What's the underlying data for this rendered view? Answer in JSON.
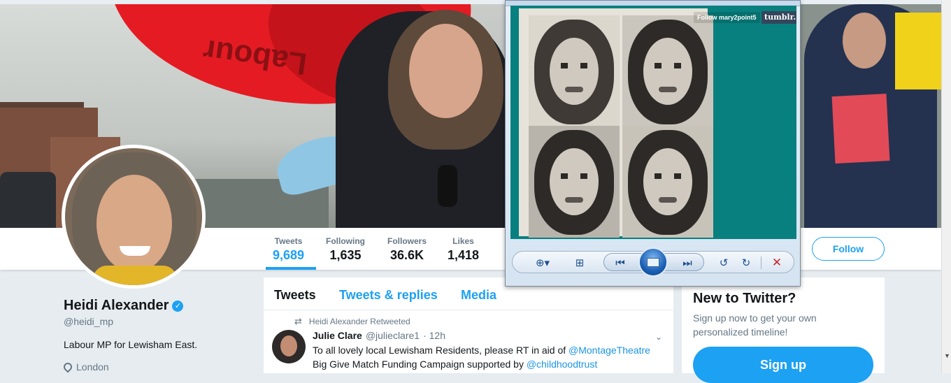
{
  "profile": {
    "name": "Heidi Alexander",
    "handle": "@heidi_mp",
    "bio": "Labour MP for Lewisham East.",
    "location": "London",
    "verified_glyph": "✓"
  },
  "banner": {
    "umbrella_text": "Labour"
  },
  "stats": [
    {
      "label": "Tweets",
      "value": "9,689"
    },
    {
      "label": "Following",
      "value": "1,635"
    },
    {
      "label": "Followers",
      "value": "36.6K"
    },
    {
      "label": "Likes",
      "value": "1,418"
    }
  ],
  "follow_label": "Follow",
  "timeline": {
    "tabs": [
      "Tweets",
      "Tweets & replies",
      "Media"
    ],
    "active_tab": "Tweets",
    "tweet": {
      "retweet_note": "Heidi Alexander Retweeted",
      "author_name": "Julie Clare",
      "author_handle": "@julieclare1",
      "time": "· 12h",
      "text_part1": "To all lovely local Lewisham Residents, please RT in aid of ",
      "mention1": "@MontageTheatre",
      "text_part2": " Big Give Match Funding Campaign supported by ",
      "mention2": "@childhoodtrust"
    }
  },
  "sidebar": {
    "title": "New to Twitter?",
    "text": "Sign up now to get your own personalized timeline!",
    "signup_label": "Sign up"
  },
  "viewer": {
    "follow_overlay": "Follow mary2point5",
    "tumblr_badge": "tumblr.",
    "icons": [
      "zoom-icon",
      "fit-to-window-icon",
      "previous-icon",
      "slideshow-icon",
      "next-icon",
      "rotate-left-icon",
      "rotate-right-icon",
      "delete-icon"
    ]
  },
  "colors": {
    "accent": "#1da1f2",
    "text": "#14171a",
    "muted": "#657786",
    "background": "#e6ecf0",
    "viewer_teal": "#08807f"
  }
}
